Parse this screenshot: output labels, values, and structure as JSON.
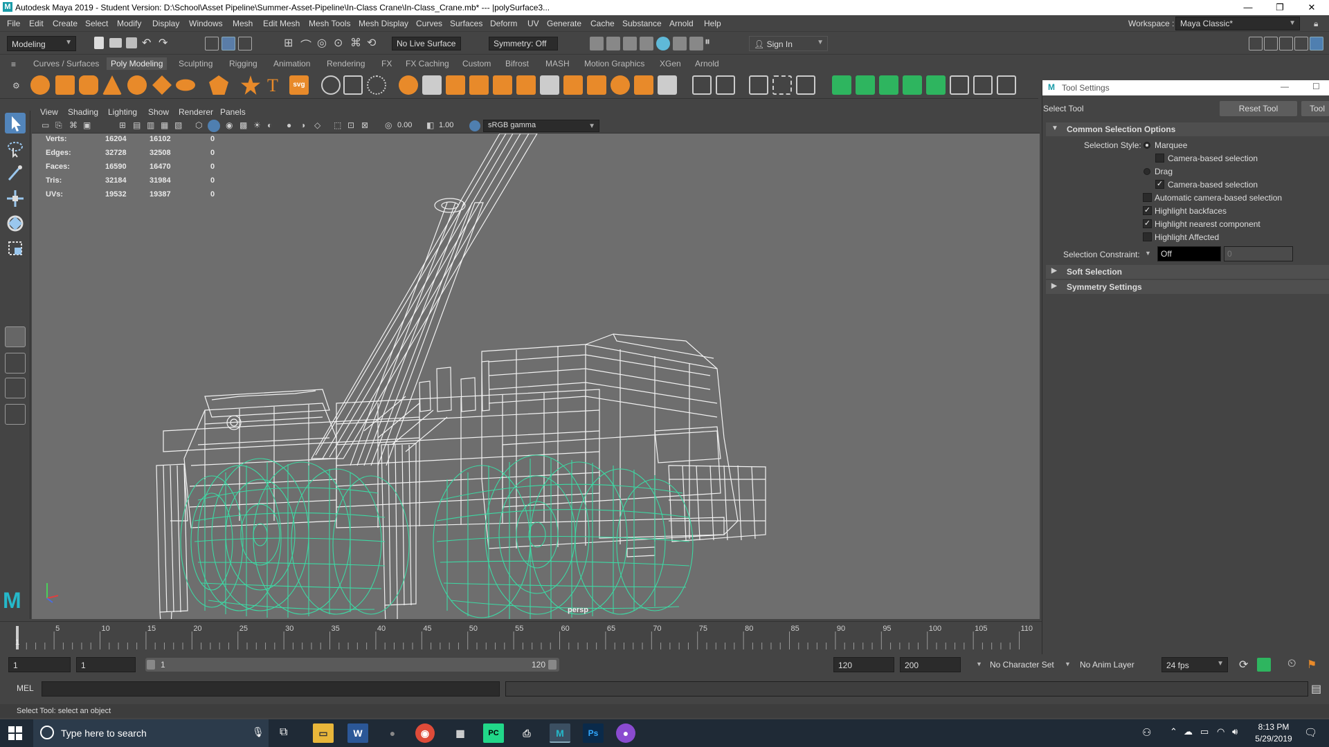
{
  "titlebar": {
    "title": "Autodesk Maya 2019 - Student Version: D:\\School\\Asset Pipeline\\Summer-Asset-Pipeline\\In-Class Crane\\In-Class_Crane.mb*   ---   |polySurface3...",
    "minimize": "—",
    "restore": "❐",
    "close": "✕"
  },
  "menubar": {
    "items": [
      "File",
      "Edit",
      "Create",
      "Select",
      "Modify",
      "Display",
      "Windows",
      "Mesh",
      "Edit Mesh",
      "Mesh Tools",
      "Mesh Display",
      "Curves",
      "Surfaces",
      "Deform",
      "UV",
      "Generate",
      "Cache",
      "Substance",
      "Arnold",
      "Help"
    ],
    "workspace_label": "Workspace :",
    "workspace_value": "Maya Classic*"
  },
  "statusline": {
    "mode": "Modeling",
    "live_surface": "No Live Surface",
    "symmetry": "Symmetry: Off",
    "sign_in": "Sign In"
  },
  "shelf": {
    "tabs": [
      "Curves / Surfaces",
      "Poly Modeling",
      "Sculpting",
      "Rigging",
      "Animation",
      "Rendering",
      "FX",
      "FX Caching",
      "Custom",
      "Bifrost",
      "MASH",
      "Motion Graphics",
      "XGen",
      "Arnold"
    ],
    "active_tab": "Poly Modeling"
  },
  "viewport": {
    "menus": [
      "View",
      "Shading",
      "Lighting",
      "Show",
      "Renderer",
      "Panels"
    ],
    "exposure": "0.00",
    "gamma": "1.00",
    "color_space": "sRGB gamma",
    "camera": "persp",
    "hud": {
      "rows": [
        {
          "label": "Verts:",
          "a": "16204",
          "b": "16102",
          "c": "0"
        },
        {
          "label": "Edges:",
          "a": "32728",
          "b": "32508",
          "c": "0"
        },
        {
          "label": "Faces:",
          "a": "16590",
          "b": "16470",
          "c": "0"
        },
        {
          "label": "Tris:",
          "a": "32184",
          "b": "31984",
          "c": "0"
        },
        {
          "label": "UVs:",
          "a": "19532",
          "b": "19387",
          "c": "0"
        }
      ]
    }
  },
  "tool_settings": {
    "window_title": "Tool Settings",
    "tool_name": "Select Tool",
    "reset_button": "Reset Tool",
    "help_button": "Tool",
    "common_section": "Common Selection Options",
    "selection_style_label": "Selection Style:",
    "marquee": "Marquee",
    "camera_based_1": "Camera-based selection",
    "drag": "Drag",
    "camera_based_2": "Camera-based selection",
    "auto_camera": "Automatic camera-based selection",
    "highlight_backfaces": "Highlight backfaces",
    "highlight_nearest": "Highlight nearest component",
    "highlight_affected": "Highlight Affected",
    "constraint_label": "Selection Constraint:",
    "constraint_value": "Off",
    "constraint_num": "0",
    "soft_selection": "Soft Selection",
    "symmetry_settings": "Symmetry Settings",
    "checked": {
      "camera_based_1": false,
      "camera_based_2": true,
      "auto_camera": false,
      "highlight_backfaces": true,
      "highlight_nearest": true,
      "highlight_affected": false
    }
  },
  "timeline": {
    "ticks": [
      "1",
      "5",
      "10",
      "15",
      "20",
      "25",
      "30",
      "35",
      "40",
      "45",
      "50",
      "55",
      "60",
      "65",
      "70",
      "75",
      "80",
      "85",
      "90",
      "95",
      "100",
      "105",
      "110"
    ],
    "current_frame": "1"
  },
  "range": {
    "start": "1",
    "playback_start": "1",
    "slider_start": "1",
    "slider_end": "120",
    "playback_end": "120",
    "end": "200",
    "character_set": "No Character Set",
    "anim_layer": "No Anim Layer",
    "fps": "24 fps"
  },
  "cmdline": {
    "language": "MEL"
  },
  "helpline": {
    "text": "Select Tool: select an object"
  },
  "taskbar": {
    "search_placeholder": "Type here to search",
    "time": "8:13 PM",
    "date": "5/29/2019"
  },
  "colors": {
    "maya_bg": "#444444",
    "viewport": "#6e6e6e",
    "wireframe": "#ffffff",
    "selected_wire": "#3dd9a4",
    "taskbar": "#1f2a36"
  }
}
